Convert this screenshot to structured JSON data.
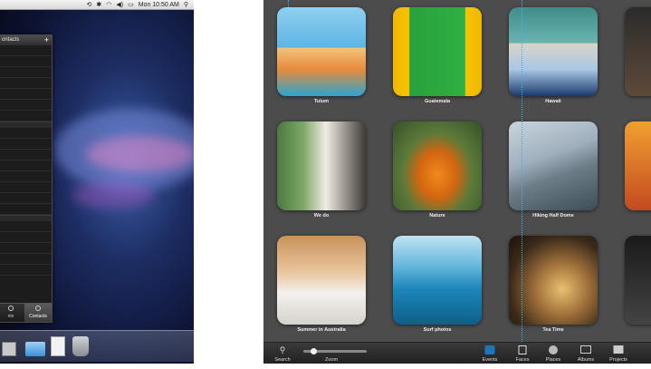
{
  "desktop": {
    "menubar": {
      "clock": "Mon 10:50 AM"
    },
    "contacts_window": {
      "header": "ontacts",
      "footer_tabs": [
        {
          "label": "nts"
        },
        {
          "label": "Contacts"
        }
      ]
    }
  },
  "iphoto": {
    "events": [
      {
        "label": "Tulum"
      },
      {
        "label": "Guatemala"
      },
      {
        "label": "Hawaii"
      },
      {
        "label": ""
      },
      {
        "label": "We do"
      },
      {
        "label": "Nature"
      },
      {
        "label": "Hiking Half Dome"
      },
      {
        "label": ""
      },
      {
        "label": "Summer in Australia"
      },
      {
        "label": "Surf photos"
      },
      {
        "label": "Tea Time"
      },
      {
        "label": ""
      }
    ],
    "toolbar": {
      "search": "Search",
      "zoom": "Zoom",
      "events": "Events",
      "faces": "Faces",
      "places": "Places",
      "albums": "Albums",
      "projects": "Projects"
    },
    "colors": {
      "background": "#4c4c4c",
      "selection": "#1a78b8",
      "guide_line": "#3fb2e0"
    }
  }
}
